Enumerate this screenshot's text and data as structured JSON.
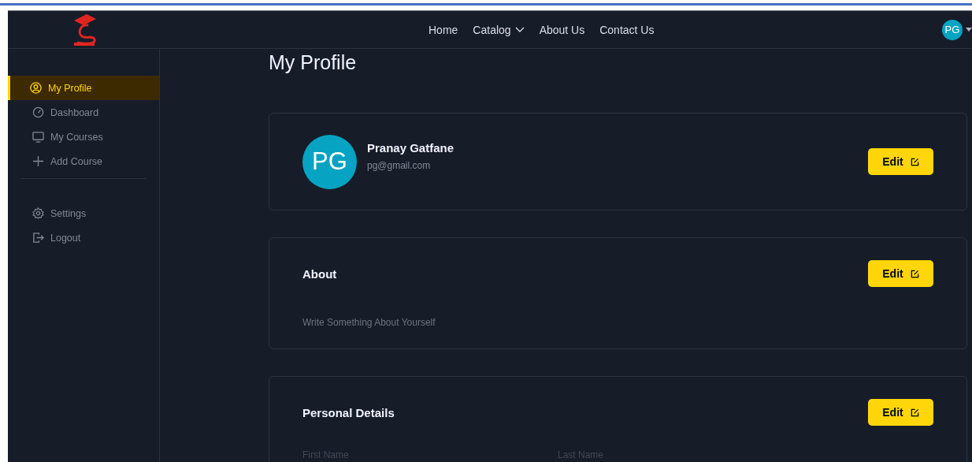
{
  "nav": {
    "links": [
      {
        "label": "Home",
        "kind": "link"
      },
      {
        "label": "Catalog",
        "kind": "dropdown"
      },
      {
        "label": "About Us",
        "kind": "link"
      },
      {
        "label": "Contact Us",
        "kind": "link"
      }
    ],
    "avatar": "PG"
  },
  "sidebar": {
    "groups": [
      [
        {
          "label": "My Profile",
          "selected": true
        },
        {
          "label": "Dashboard",
          "selected": false
        },
        {
          "label": "My Courses",
          "selected": false
        },
        {
          "label": "Add Course",
          "selected": false
        }
      ],
      [
        {
          "label": "Settings",
          "selected": false
        },
        {
          "label": "Logout",
          "selected": false
        }
      ]
    ]
  },
  "title": "My Profile",
  "profile": {
    "initials": "PG",
    "name": "Pranay Gatfane",
    "email": "pg@gmail.com",
    "button": "Edit"
  },
  "about": {
    "heading": "About",
    "text": "Write Something About Yourself",
    "button": "Edit"
  },
  "personal": {
    "heading": "Personal Details",
    "button": "Edit",
    "fields": [
      "First Name",
      "Last Name"
    ]
  }
}
